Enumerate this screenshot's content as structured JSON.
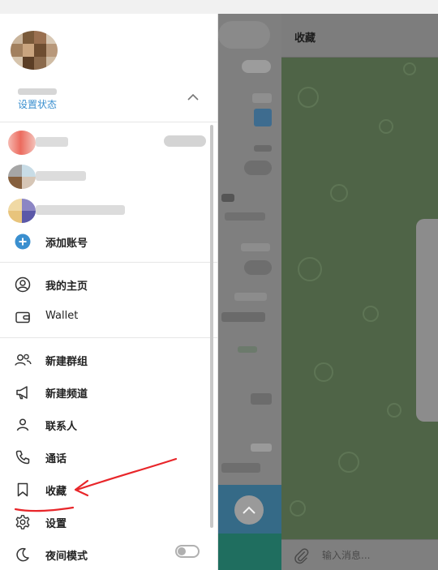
{
  "background": {
    "chat_title": "收藏",
    "message_input_placeholder": "输入消息..."
  },
  "drawer": {
    "set_status_label": "设置状态",
    "add_account_label": "添加账号",
    "menu": [
      {
        "label": "我的主页",
        "icon": "user-circle-icon"
      },
      {
        "label": "Wallet",
        "icon": "wallet-icon"
      },
      {
        "label": "新建群组",
        "icon": "group-icon"
      },
      {
        "label": "新建频道",
        "icon": "megaphone-icon"
      },
      {
        "label": "联系人",
        "icon": "person-icon"
      },
      {
        "label": "通话",
        "icon": "phone-icon"
      },
      {
        "label": "收藏",
        "icon": "bookmark-icon"
      },
      {
        "label": "设置",
        "icon": "gear-icon"
      },
      {
        "label": "夜间模式",
        "icon": "moon-icon"
      }
    ],
    "night_mode_on": false
  },
  "colors": {
    "accent": "#3a8fcf",
    "annotation_red": "#e8262a"
  }
}
